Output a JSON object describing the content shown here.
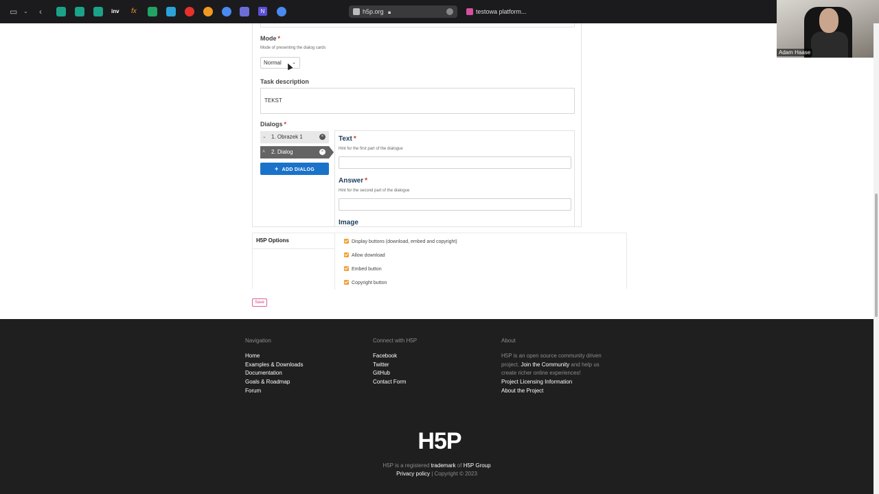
{
  "browser": {
    "active_tab": "h5p.org",
    "other_tab": "testowa platform...",
    "toolbar_glyph_inv": "inv",
    "toolbar_glyph_fx": "fx",
    "toolbar_glyph_n": "N"
  },
  "webcam": {
    "name": "Adam Haase"
  },
  "editor": {
    "mode_label": "Mode",
    "mode_hint": "Mode of presenting the dialog cards",
    "mode_value": "Normal",
    "task_label": "Task description",
    "task_value": "TEKST",
    "dialogs_label": "Dialogs",
    "dialog_items": [
      "1. Obrazek 1",
      "2. Dialog"
    ],
    "add_dialog": "ADD DIALOG",
    "text_label": "Text",
    "text_hint": "Hint for the first part of the dialogue",
    "answer_label": "Answer",
    "answer_hint": "Hint for the second part of the dialogue",
    "image_label": "Image"
  },
  "options": {
    "title": "H5P Options",
    "items": [
      "Display buttons (download, embed and copyright)",
      "Allow download",
      "Embed button",
      "Copyright button"
    ]
  },
  "save_label": "Save",
  "footer": {
    "nav_title": "Navigation",
    "nav_links": [
      "Home",
      "Examples & Downloads",
      "Documentation",
      "Goals & Roadmap",
      "Forum"
    ],
    "connect_title": "Connect with H5P",
    "connect_links": [
      "Facebook",
      "Twitter",
      "GitHub",
      "Contact Form"
    ],
    "about_title": "About",
    "about_text_1": "H5P is an open source community driven project.",
    "about_join": "Join the Community",
    "about_text_2": "and help us create richer online experiences!",
    "about_links": [
      "Project Licensing Information",
      "About the Project"
    ],
    "logo": "H5P",
    "trademark_1": "H5P is a registered",
    "trademark_link": "trademark",
    "trademark_2": "of",
    "trademark_group": "H5P Group",
    "privacy": "Privacy policy",
    "copyright": "| Copyright © 2023"
  },
  "colors": {
    "accent_blue": "#1a73c9",
    "checkbox_orange": "#f0a030",
    "footer_bg": "#1f1f1f",
    "save_pink": "#e05c9c"
  }
}
